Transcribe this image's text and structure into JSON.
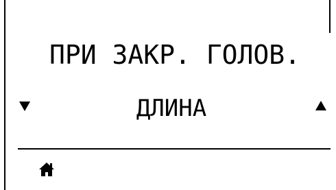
{
  "screen": {
    "title": "ПРИ ЗАКР. ГОЛОВ.",
    "value": "ДЛИНА"
  },
  "icons": {
    "prev": "down-triangle-icon",
    "next": "up-triangle-icon",
    "home": "home-icon"
  },
  "colors": {
    "background": "#ffffff",
    "foreground": "#000000"
  }
}
